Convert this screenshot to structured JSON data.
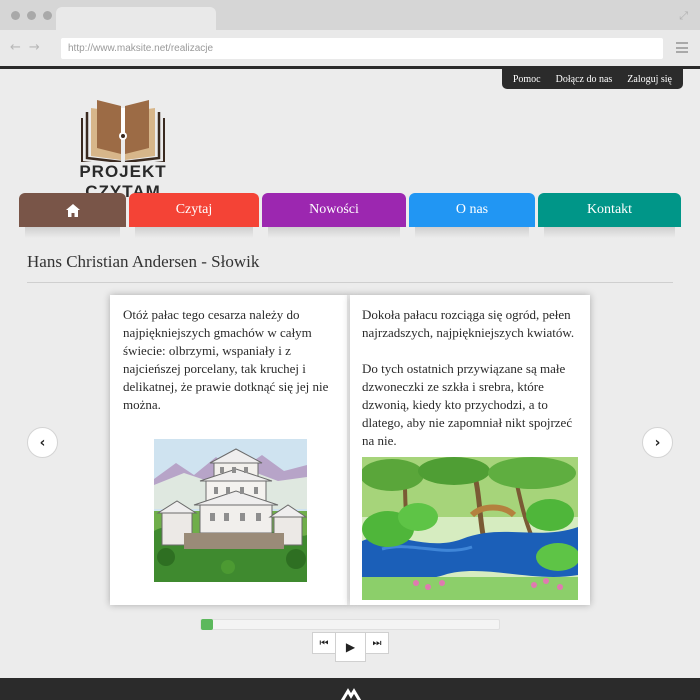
{
  "browser": {
    "url": "http://www.maksite.net/realizacje",
    "back_icon": "back-arrow-icon",
    "forward_icon": "forward-arrow-icon",
    "menu_icon": "hamburger-menu-icon"
  },
  "top_links": [
    "Pomoc",
    "Dołącz do nas",
    "Zaloguj się"
  ],
  "logo": {
    "text": "PROJEKT CZYTAM",
    "icon": "open-book-icon"
  },
  "nav": [
    {
      "label": "",
      "icon": "home-icon",
      "color": "#795548"
    },
    {
      "label": "Czytaj",
      "color": "#f44336"
    },
    {
      "label": "Nowości",
      "color": "#9c27b0"
    },
    {
      "label": "O nas",
      "color": "#2196f3"
    },
    {
      "label": "Kontakt",
      "color": "#009688"
    }
  ],
  "book": {
    "title": "Hans Christian Andersen - Słowik",
    "left_page_text": "Otóż pałac tego cesarza należy do najpiękniejszych gmachów w całym świecie: olbrzymi, wspaniały i z najcieńszej porcelany, tak kruchej i delikatnej, że prawie dotknąć się jej nie można.",
    "right_page_text_1": "Dokoła pałacu rozciąga się ogród, pełen najrzadszych, najpiękniejszych kwiatów.",
    "right_page_text_2": "Do tych ostatnich przywiązane są małe dzwoneczki ze szkła i srebra, które dzwonią, kiedy kto przychodzi, a to dlatego, aby nie zapomniał nikt spojrzeć na nie.",
    "left_illustration": "porcelain-palace-illustration",
    "right_illustration": "garden-pond-illustration",
    "prev_icon": "chevron-left-icon",
    "next_icon": "chevron-right-icon",
    "progress": 0.04
  },
  "player": {
    "rewind_glyph": "⏮",
    "play_glyph": "▶",
    "forward_glyph": "⏭"
  },
  "colors": {
    "page_bg": "#ececec",
    "progress": "#5cb85c",
    "dark": "#2b2b2b"
  }
}
